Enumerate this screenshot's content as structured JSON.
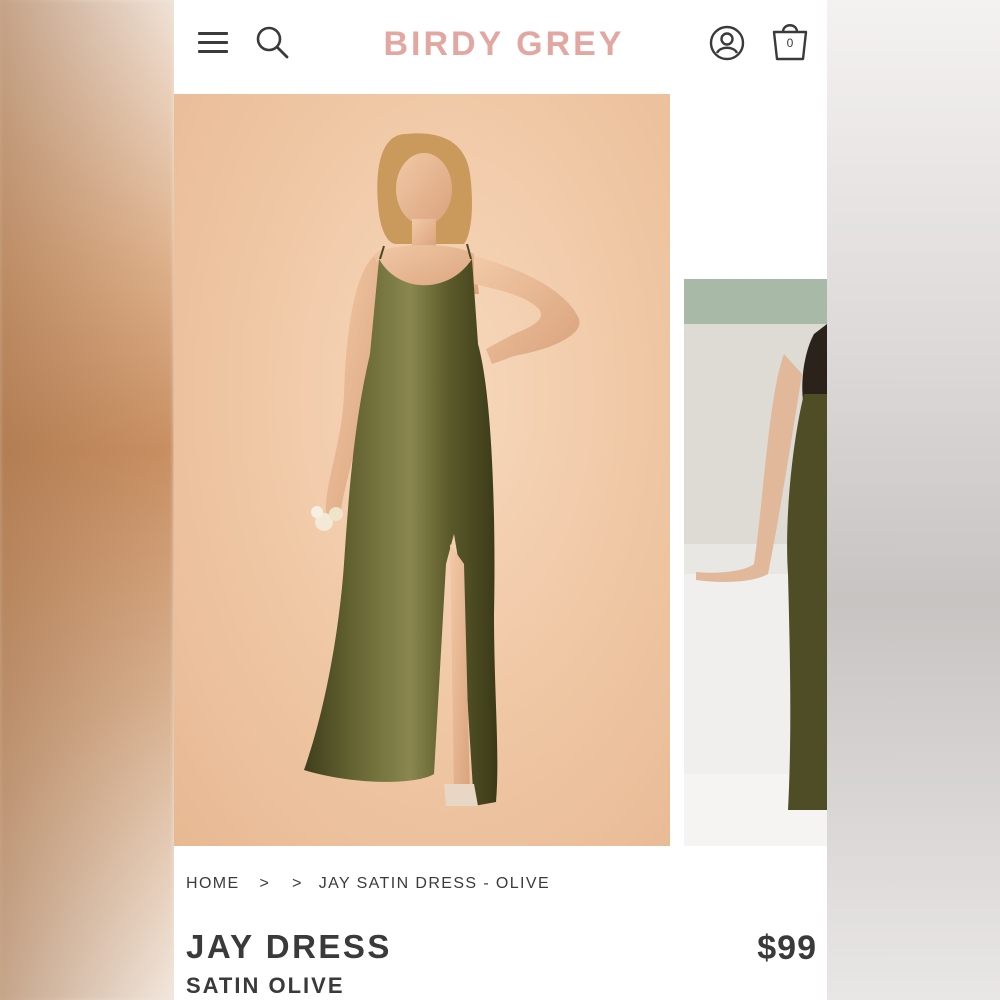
{
  "header": {
    "logo_text": "BIRDY GREY",
    "logo_color": "#e2a7a1",
    "cart_count": "0",
    "icons": [
      "menu-icon",
      "search-icon",
      "account-icon",
      "bag-icon"
    ]
  },
  "gallery": {
    "slides": [
      {
        "subject": "model in olive satin slip dress on peach backdrop"
      },
      {
        "subject": "model in olive satin dress by a window"
      }
    ],
    "accent_colors": {
      "dress": "#5a5a2c",
      "backdrop": "#efc6a3"
    }
  },
  "breadcrumb": {
    "home": "HOME",
    "separator_1": ">",
    "separator_2": ">",
    "current": "JAY SATIN DRESS - OLIVE"
  },
  "product": {
    "title": "JAY DRESS",
    "variant": "SATIN OLIVE",
    "price": "$99"
  }
}
